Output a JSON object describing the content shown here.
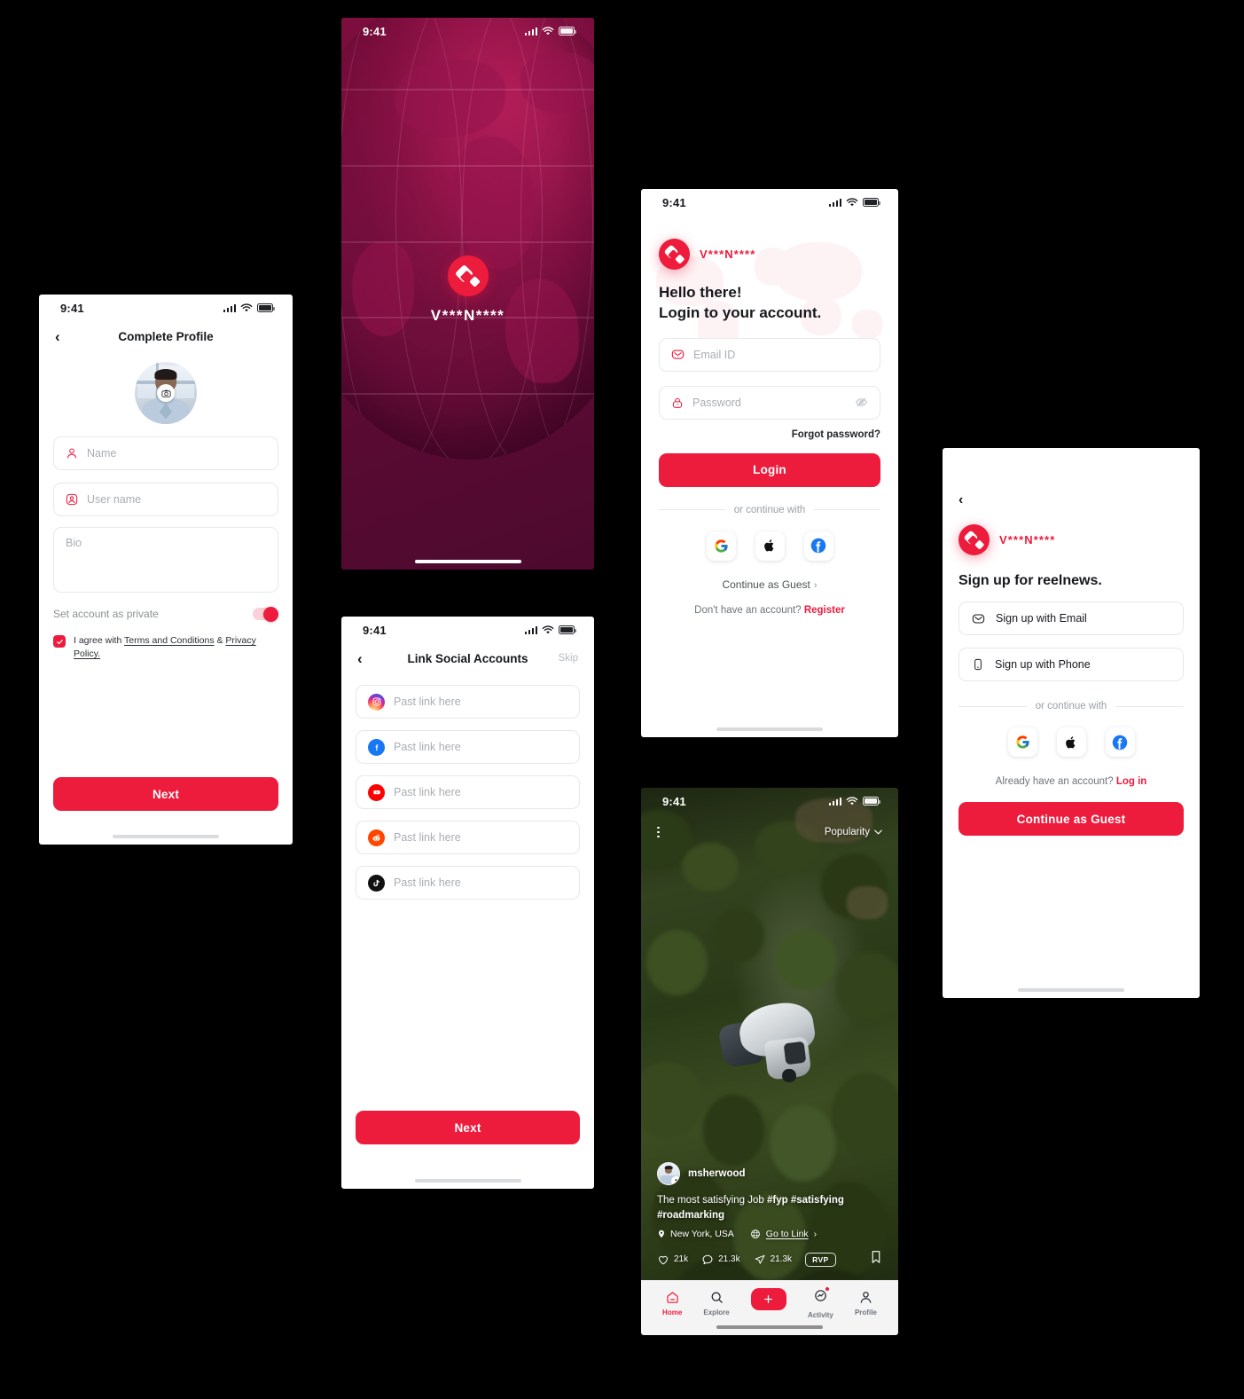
{
  "brand": {
    "name": "V***N****",
    "accent": "#ed1b3c"
  },
  "status_bar": {
    "time": "9:41"
  },
  "profile_screen": {
    "nav_title": "Complete Profile",
    "back_icon": "chevron-left-icon",
    "fields": [
      {
        "icon": "user-icon",
        "placeholder": "Name"
      },
      {
        "icon": "user-card-icon",
        "placeholder": "User name"
      }
    ],
    "bio_placeholder": "Bio",
    "private_label": "Set account as private",
    "private_enabled": true,
    "agree_prefix": "I agree with ",
    "agree_terms": "Terms and Conditions",
    "agree_amp": " & ",
    "agree_privacy": "Privacy Policy.",
    "agree_checked": true,
    "next_label": "Next"
  },
  "splash_screen": {
    "app_name": "V***N****"
  },
  "login_screen": {
    "brand_name": "V***N****",
    "heading_line1": "Hello there!",
    "heading_line2": "Login to your account.",
    "email_placeholder": "Email ID",
    "password_placeholder": "Password",
    "forgot_label": "Forgot password?",
    "login_label": "Login",
    "divider_label": "or continue with",
    "socials": [
      "google-icon",
      "apple-icon",
      "facebook-icon"
    ],
    "guest_label": "Continue as Guest",
    "register_prefix": "Don't have an account? ",
    "register_label": "Register"
  },
  "social_screen": {
    "nav_title": "Link Social Accounts",
    "skip_label": "Skip",
    "rows": [
      {
        "icon": "instagram-icon",
        "placeholder": "Past link here"
      },
      {
        "icon": "facebook-icon",
        "placeholder": "Past link here"
      },
      {
        "icon": "youtube-icon",
        "placeholder": "Past link here"
      },
      {
        "icon": "reddit-icon",
        "placeholder": "Past link here"
      },
      {
        "icon": "tiktok-icon",
        "placeholder": "Past link here"
      }
    ],
    "next_label": "Next"
  },
  "signup_screen": {
    "brand_name": "V***N****",
    "title": "Sign up for reelnews.",
    "options": [
      {
        "icon": "mail-icon",
        "label": "Sign up with Email"
      },
      {
        "icon": "phone-icon",
        "label": "Sign up with Phone"
      }
    ],
    "divider_label": "or continue with",
    "socials": [
      "google-icon",
      "apple-icon",
      "facebook-icon"
    ],
    "already_prefix": "Already have an account? ",
    "login_label": "Log in",
    "guest_label": "Continue as Guest"
  },
  "feed_screen": {
    "sort_label": "Popularity",
    "username": "msherwood",
    "caption_plain": "The most satisfying Job ",
    "caption_tags": "#fyp #satisfying #roadmarking",
    "location": "New York, USA",
    "link_label": "Go to Link",
    "likes": "21k",
    "comments": "21.3k",
    "shares": "21.3k",
    "rvp_label": "RVP",
    "tabs": [
      {
        "icon": "home-icon",
        "label": "Home",
        "active": true
      },
      {
        "icon": "search-icon",
        "label": "Explore",
        "active": false
      },
      {
        "icon": "plus-icon",
        "label": "",
        "active": false
      },
      {
        "icon": "activity-icon",
        "label": "Activity",
        "active": false
      },
      {
        "icon": "profile-icon",
        "label": "Profile",
        "active": false
      }
    ]
  }
}
